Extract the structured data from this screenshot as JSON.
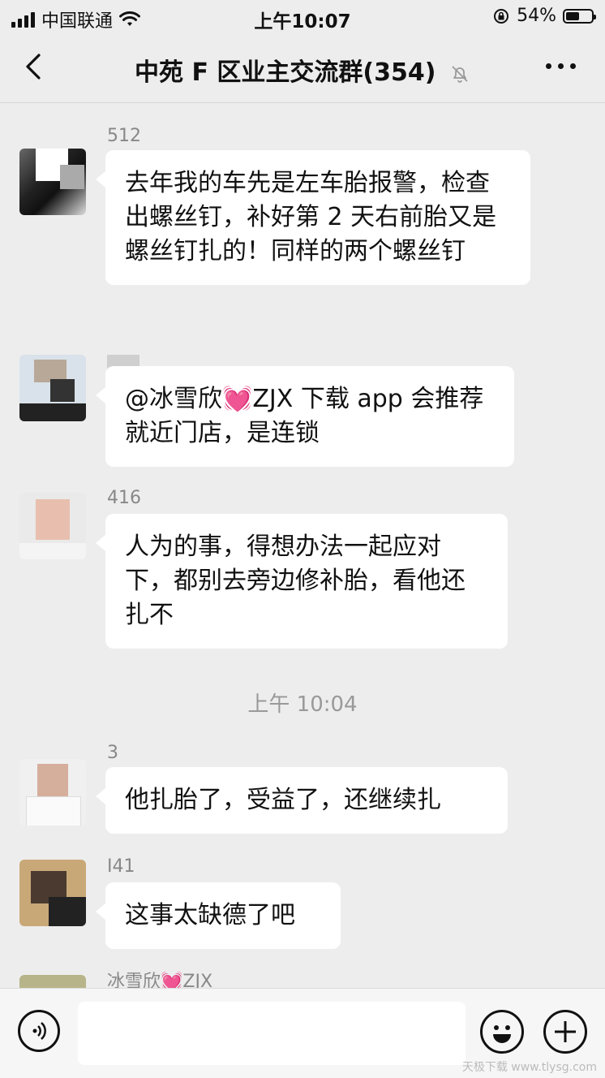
{
  "status_bar": {
    "carrier": "中国联通",
    "time": "上午10:07",
    "battery": "54%",
    "battery_level": 0.54
  },
  "header": {
    "title": "中苑 F 区业主交流群(354)",
    "back_icon": "chevron-left-icon",
    "mute_icon": "bell-off-icon",
    "more_icon": "more-dots-icon"
  },
  "messages": [
    {
      "nick": "512",
      "text": "去年我的车先是左车胎报警，检查出螺丝钉，补好第 2 天右前胎又是螺丝钉扎的！同样的两个螺丝钉"
    },
    {
      "nick": "",
      "text_before": "@冰雪欣",
      "emoji": "💓",
      "text_after": "ZJX 下载 app 会推荐就近门店，是连锁"
    },
    {
      "nick": "416",
      "text": "人为的事，得想办法一起应对下，都别去旁边修补胎，看他还扎不"
    },
    {
      "timestamp": "上午 10:04"
    },
    {
      "nick": "3",
      "text": "他扎胎了，受益了，还继续扎"
    },
    {
      "nick": "I41",
      "text": "这事太缺德了吧"
    },
    {
      "nick_before": "冰雪欣",
      "nick_emoji": "💓",
      "nick_after": "ZJX"
    }
  ],
  "input_bar": {
    "voice_icon": "voice-icon",
    "emoji_icon": "emoji-icon",
    "plus_icon": "plus-icon"
  },
  "watermark": "天极下载 www.tlysg.com"
}
